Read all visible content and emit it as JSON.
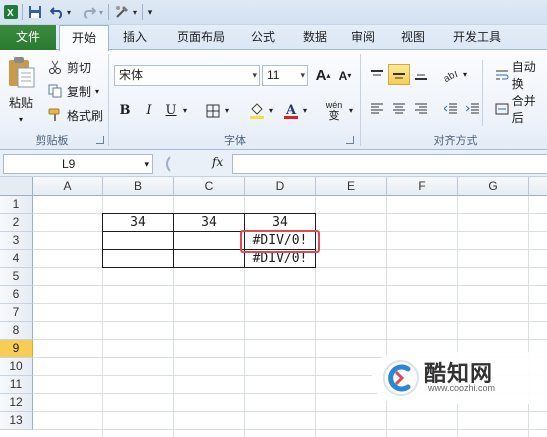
{
  "quick_access": {
    "icons": [
      "excel-app-icon",
      "save-icon",
      "undo-icon",
      "redo-icon",
      "custom-tool-icon",
      "qat-dropdown-icon"
    ]
  },
  "tabs": [
    {
      "label": "文件",
      "active": false
    },
    {
      "label": "开始",
      "active": true
    },
    {
      "label": "插入",
      "active": false
    },
    {
      "label": "页面布局",
      "active": false
    },
    {
      "label": "公式",
      "active": false
    },
    {
      "label": "数据",
      "active": false
    },
    {
      "label": "审阅",
      "active": false
    },
    {
      "label": "视图",
      "active": false
    },
    {
      "label": "开发工具",
      "active": false
    }
  ],
  "clipboard": {
    "paste_label": "粘贴",
    "cut_label": "剪切",
    "copy_label": "复制",
    "format_painter_label": "格式刷",
    "group_label": "剪贴板"
  },
  "font": {
    "font_name": "宋体",
    "font_size": "11",
    "bold": "B",
    "italic": "I",
    "underline": "U",
    "grow": "A",
    "shrink": "A",
    "wen": "wén",
    "wen_char": "变",
    "group_label": "字体",
    "font_color": "#e02020",
    "fill_color": "#f5e03a"
  },
  "alignment": {
    "wrap_text_label": "自动换",
    "merge_label": "合并后",
    "group_label": "对齐方式"
  },
  "formula_bar": {
    "name_box": "L9",
    "fx": "fx",
    "formula": ""
  },
  "sheet": {
    "columns": [
      "A",
      "B",
      "C",
      "D",
      "E",
      "F",
      "G"
    ],
    "rows": [
      "1",
      "2",
      "3",
      "4",
      "5",
      "6",
      "7",
      "8",
      "9",
      "10",
      "11",
      "12",
      "13"
    ],
    "selected_row": "9",
    "cells": {
      "B2": "34",
      "C2": "34",
      "D2": "34",
      "D3": "#DIV/0!",
      "D4": "#DIV/0!"
    },
    "highlight_color": "#e04a55"
  },
  "watermark": {
    "title": "酷知网",
    "url": "www.coozhi.com"
  }
}
